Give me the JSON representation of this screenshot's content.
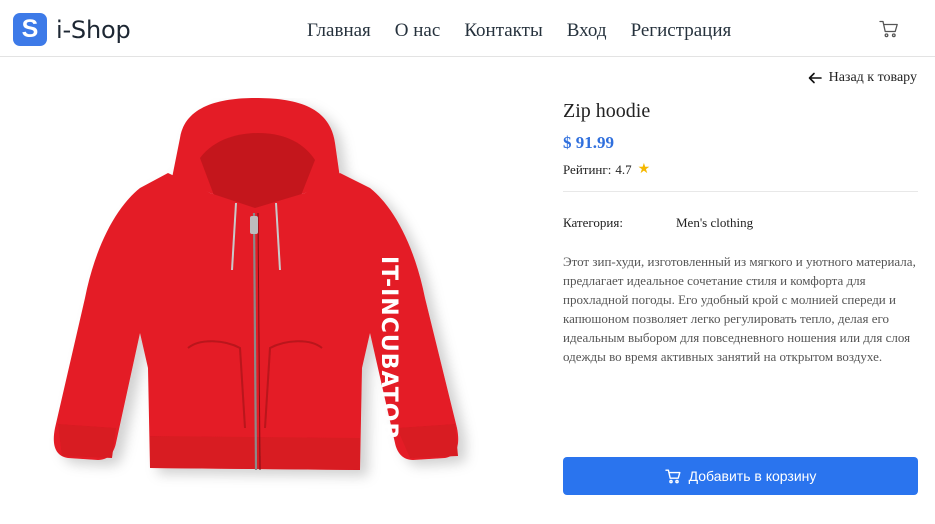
{
  "header": {
    "logo_letter": "S",
    "logo_text": "i-Shop",
    "nav": [
      "Главная",
      "О нас",
      "Контакты",
      "Вход",
      "Регистрация"
    ],
    "cart_icon": "cart-icon"
  },
  "back_link": {
    "label": "Назад к товару",
    "icon": "arrow-left-icon"
  },
  "product": {
    "title": "Zip hoodie",
    "price": "$ 91.99",
    "rating_label": "Рейтинг:",
    "rating_value": "4.7",
    "rating_icon": "star-icon",
    "category_label": "Категория:",
    "category_value": "Men's clothing",
    "description": "Этот зип-худи, изготовленный из мягкого и уютного материала, предлагает идеальное сочетание стиля и комфорта для прохладной погоды. Его удобный крой с молнией спереди и капюшоном позволяет легко регулировать тепло, делая его идеальным выбором для повседневного ношения или для слоя одежды во время активных занятий на открытом воздухе.",
    "image": {
      "sleeve_text": "IT-INCUBATOR",
      "color": "#e41c26"
    }
  },
  "actions": {
    "add_to_cart": "Добавить в корзину"
  },
  "colors": {
    "accent": "#2a74ee",
    "price": "#2f6fdd",
    "star": "#f5b800",
    "logo": "#3d7ae8"
  }
}
